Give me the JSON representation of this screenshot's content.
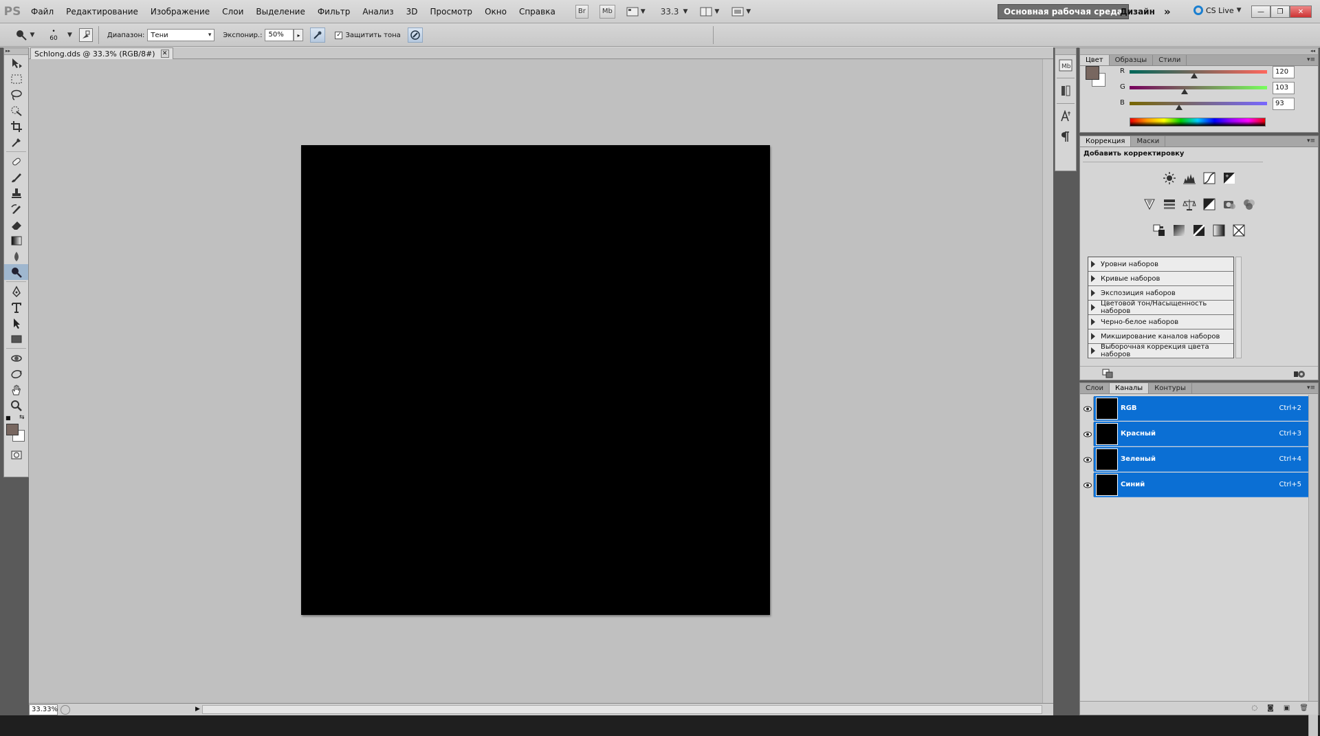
{
  "menu": {
    "logo": "PS",
    "items": [
      "Файл",
      "Редактирование",
      "Изображение",
      "Слои",
      "Выделение",
      "Фильтр",
      "Анализ",
      "3D",
      "Просмотр",
      "Окно",
      "Справка"
    ],
    "br_icon": "Br",
    "mb_icon": "Mb",
    "zoom": "33.3",
    "workspace_active": "Основная рабочая среда",
    "workspace_design": "Дизайн",
    "more": "»",
    "cs_live": "CS Live"
  },
  "options": {
    "brush_size": "60",
    "range_label": "Диапазон:",
    "range_value": "Тени",
    "exposure_label": "Экспонир.:",
    "exposure_value": "50%",
    "protect_tones_label": "Защитить тона",
    "protect_tones_checked": true,
    "protect_tones_mark": "✓"
  },
  "document": {
    "tab_title": "Schlong.dds @ 33.3% (RGB/8#)",
    "close_glyph": "✕",
    "status_zoom": "33.33%",
    "canvas_color": "#000000"
  },
  "tools": {
    "foreground_color": "#786760",
    "background_color": "#ffffff",
    "icons": [
      "move-icon",
      "marquee-icon",
      "lasso-icon",
      "quick-select-icon",
      "crop-icon",
      "eyedropper-icon",
      "healing-brush-icon",
      "brush-icon",
      "clone-stamp-icon",
      "history-brush-icon",
      "eraser-icon",
      "gradient-icon",
      "blur-icon",
      "dodge-burn-icon",
      "pen-icon",
      "type-icon",
      "path-select-icon",
      "shape-icon",
      "3d-rotate-icon",
      "3d-orbit-icon",
      "hand-icon",
      "zoom-icon"
    ]
  },
  "color_panel": {
    "tabs": [
      "Цвет",
      "Образцы",
      "Стили"
    ],
    "active_tab": "Цвет",
    "channels": [
      {
        "label": "R",
        "value": "120",
        "fraction": 0.47
      },
      {
        "label": "G",
        "value": "103",
        "fraction": 0.4
      },
      {
        "label": "B",
        "value": "93",
        "fraction": 0.36
      }
    ]
  },
  "adjustments_panel": {
    "tabs": [
      "Коррекция",
      "Маски"
    ],
    "active_tab": "Коррекция",
    "title": "Добавить корректировку",
    "presets": [
      "Уровни наборов",
      "Кривые наборов",
      "Экспозиция наборов",
      "Цветовой тон/Насыщенность наборов",
      "Черно-белое наборов",
      "Микширование каналов наборов",
      "Выборочная коррекция цвета наборов"
    ]
  },
  "channels_panel": {
    "tabs": [
      "Слои",
      "Каналы",
      "Контуры"
    ],
    "active_tab": "Каналы",
    "channels": [
      {
        "name": "RGB",
        "shortcut": "Ctrl+2"
      },
      {
        "name": "Красный",
        "shortcut": "Ctrl+3"
      },
      {
        "name": "Зеленый",
        "shortcut": "Ctrl+4"
      },
      {
        "name": "Синий",
        "shortcut": "Ctrl+5"
      }
    ],
    "selected_color": "#0b6fd4"
  }
}
